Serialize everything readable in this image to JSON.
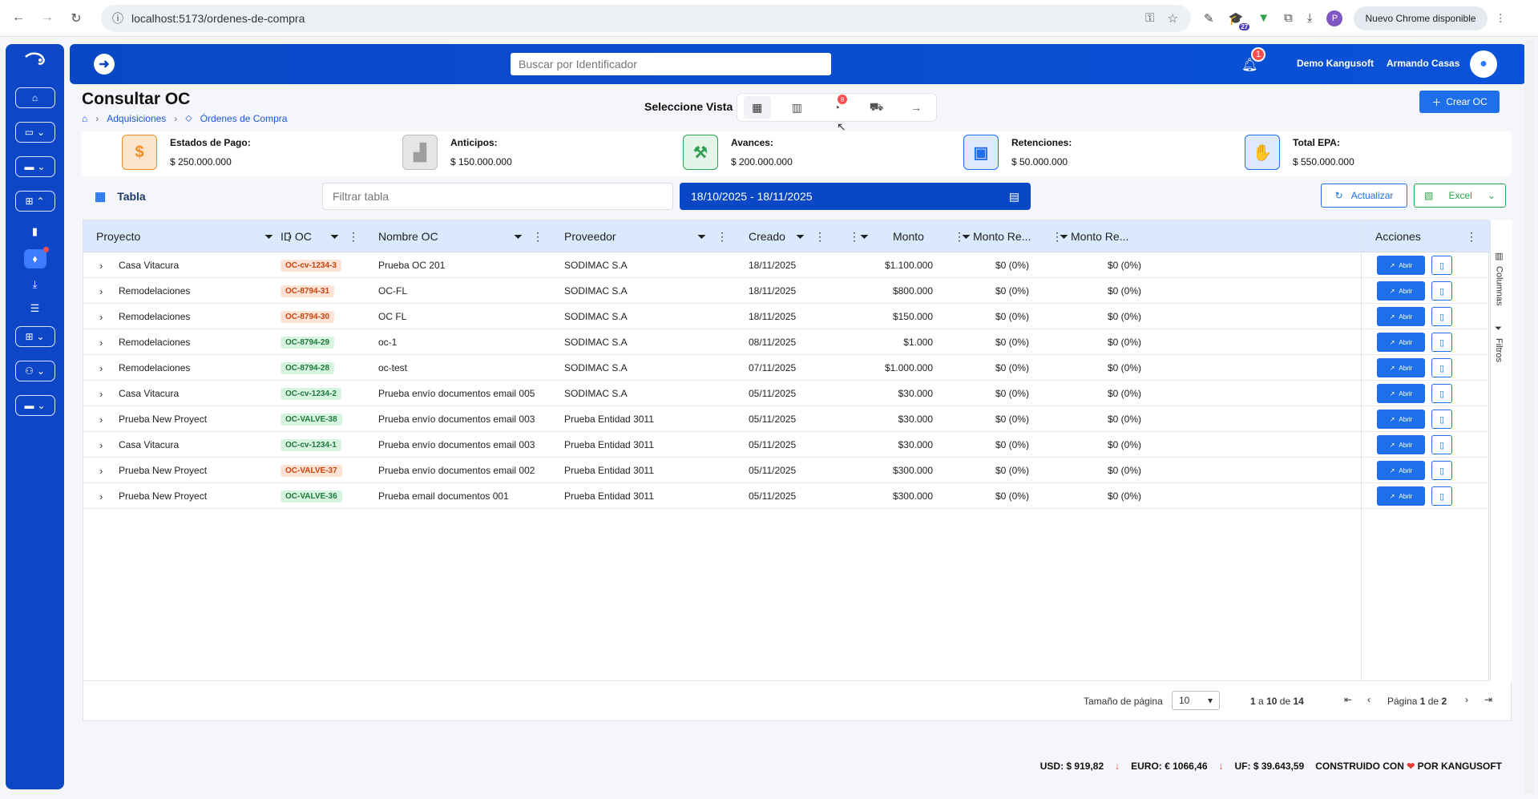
{
  "browser": {
    "url": "localhost:5173/ordenes-de-compra",
    "update_label": "Nuevo Chrome disponible",
    "profile_initial": "P",
    "ext_badge": "27"
  },
  "header": {
    "search_placeholder": "Buscar por Identificador",
    "notification_count": "1",
    "company": "Demo Kangusoft",
    "user": "Armando Casas"
  },
  "page": {
    "title": "Consultar OC",
    "breadcrumb": [
      "Adquisiciones",
      "Órdenes de Compra"
    ],
    "view_label": "Seleccione Vista",
    "view_badge": "8",
    "create_label": "Crear OC"
  },
  "summary": [
    {
      "label": "Estados de Pago:",
      "value": "$ 250.000.000",
      "icon": "dollar-icon",
      "color": "#f28c28"
    },
    {
      "label": "Anticipos:",
      "value": "$ 150.000.000",
      "icon": "anticipos-icon",
      "color": "#9e9e9e"
    },
    {
      "label": "Avances:",
      "value": "$ 200.000.000",
      "icon": "hammer-icon",
      "color": "#2e9e4f"
    },
    {
      "label": "Retenciones:",
      "value": "$ 50.000.000",
      "icon": "wallet-icon",
      "color": "#1f6feb"
    },
    {
      "label": "Total EPA:",
      "value": "$ 550.000.000",
      "icon": "handshake-icon",
      "color": "#1f6feb"
    }
  ],
  "controls": {
    "tabla_label": "Tabla",
    "filter_placeholder": "Filtrar tabla",
    "date_range": "18/10/2025 - 18/11/2025",
    "refresh_label": "Actualizar",
    "excel_label": "Excel"
  },
  "table": {
    "columns": [
      "Proyecto",
      "ID OC",
      "Nombre OC",
      "Proveedor",
      "Creado",
      "Monto",
      "Monto Re...",
      "Monto Re...",
      "Acciones"
    ],
    "open_label": "Abrir",
    "rows": [
      {
        "proyecto": "Casa Vitacura",
        "id": "OC-cv-1234-3",
        "status": "orange",
        "nombre": "Prueba OC 201",
        "proveedor": "SODIMAC S.A",
        "creado": "18/11/2025",
        "monto": "$1.100.000",
        "m1": "$0 (0%)",
        "m2": "$0 (0%)"
      },
      {
        "proyecto": "Remodelaciones",
        "id": "OC-8794-31",
        "status": "orange",
        "nombre": "OC-FL",
        "proveedor": "SODIMAC S.A",
        "creado": "18/11/2025",
        "monto": "$800.000",
        "m1": "$0 (0%)",
        "m2": "$0 (0%)"
      },
      {
        "proyecto": "Remodelaciones",
        "id": "OC-8794-30",
        "status": "orange",
        "nombre": "OC FL",
        "proveedor": "SODIMAC S.A",
        "creado": "18/11/2025",
        "monto": "$150.000",
        "m1": "$0 (0%)",
        "m2": "$0 (0%)"
      },
      {
        "proyecto": "Remodelaciones",
        "id": "OC-8794-29",
        "status": "green",
        "nombre": "oc-1",
        "proveedor": "SODIMAC S.A",
        "creado": "08/11/2025",
        "monto": "$1.000",
        "m1": "$0 (0%)",
        "m2": "$0 (0%)"
      },
      {
        "proyecto": "Remodelaciones",
        "id": "OC-8794-28",
        "status": "green",
        "nombre": "oc-test",
        "proveedor": "SODIMAC S.A",
        "creado": "07/11/2025",
        "monto": "$1.000.000",
        "m1": "$0 (0%)",
        "m2": "$0 (0%)"
      },
      {
        "proyecto": "Casa Vitacura",
        "id": "OC-cv-1234-2",
        "status": "green",
        "nombre": "Prueba envío documentos email 005",
        "proveedor": "SODIMAC S.A",
        "creado": "05/11/2025",
        "monto": "$30.000",
        "m1": "$0 (0%)",
        "m2": "$0 (0%)"
      },
      {
        "proyecto": "Prueba New Proyect",
        "id": "OC-VALVE-38",
        "status": "green",
        "nombre": "Prueba envío documentos email 003",
        "proveedor": "Prueba Entidad 3011",
        "creado": "05/11/2025",
        "monto": "$30.000",
        "m1": "$0 (0%)",
        "m2": "$0 (0%)"
      },
      {
        "proyecto": "Casa Vitacura",
        "id": "OC-cv-1234-1",
        "status": "green",
        "nombre": "Prueba envío documentos email 003",
        "proveedor": "Prueba Entidad 3011",
        "creado": "05/11/2025",
        "monto": "$30.000",
        "m1": "$0 (0%)",
        "m2": "$0 (0%)"
      },
      {
        "proyecto": "Prueba New Proyect",
        "id": "OC-VALVE-37",
        "status": "orange",
        "nombre": "Prueba envío documentos email 002",
        "proveedor": "Prueba Entidad 3011",
        "creado": "05/11/2025",
        "monto": "$300.000",
        "m1": "$0 (0%)",
        "m2": "$0 (0%)"
      },
      {
        "proyecto": "Prueba New Proyect",
        "id": "OC-VALVE-36",
        "status": "green",
        "nombre": "Prueba email documentos 001",
        "proveedor": "Prueba Entidad 3011",
        "creado": "05/11/2025",
        "monto": "$300.000",
        "m1": "$0 (0%)",
        "m2": "$0 (0%)"
      }
    ],
    "side_tools": [
      "Columnas",
      "Filtros"
    ]
  },
  "pager": {
    "size_label": "Tamaño de página",
    "size_value": "10",
    "range_from": "1",
    "range_a": "a",
    "range_to": "10",
    "range_de": "de",
    "total": "14",
    "page_label": "Página",
    "page_current": "1",
    "page_de": "de",
    "page_total": "2"
  },
  "footer": {
    "usd": "USD: $ 919,82",
    "euro": "EURO: € 1066,46",
    "uf": "UF: $ 39.643,59",
    "built_prefix": "CONSTRUIDO CON",
    "built_suffix": "POR KANGUSOFT"
  }
}
